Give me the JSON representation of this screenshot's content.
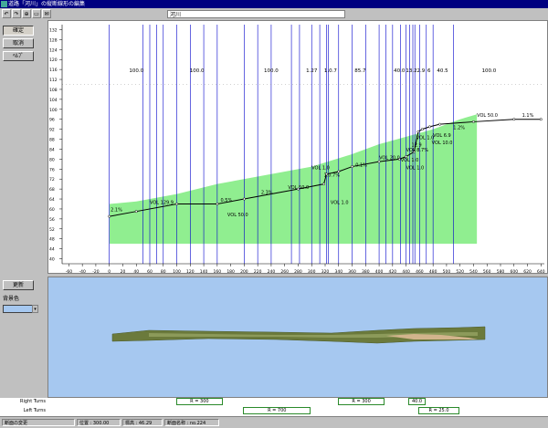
{
  "window": {
    "title": "道路「河川」の縦断線形の編集"
  },
  "toolbar": {
    "buttons": [
      {
        "name": "undo-icon",
        "glyph": "↶"
      },
      {
        "name": "redo-icon",
        "glyph": "↷"
      },
      {
        "name": "zoom-icon",
        "glyph": "⊕"
      },
      {
        "name": "page-icon",
        "glyph": "▭"
      },
      {
        "name": "mail-icon",
        "glyph": "✉"
      }
    ],
    "name_value": "河川"
  },
  "left_panel": {
    "edit_label": "確定",
    "cancel_label": "取消",
    "help_label": "ﾍﾙﾌﾟ",
    "update_label": "更新",
    "bgcolor_label": "背景色",
    "bgcolor_value": "#a6c8f0"
  },
  "chart_data": {
    "type": "line",
    "segment_lengths": [
      {
        "x": 40,
        "label": "100.0"
      },
      {
        "x": 130,
        "label": "100.0"
      },
      {
        "x": 240,
        "label": "100.0"
      },
      {
        "x": 300,
        "label": "1.27"
      },
      {
        "x": 328,
        "label": "1.0.7"
      },
      {
        "x": 372,
        "label": "85.7"
      },
      {
        "x": 430,
        "label": "40.0"
      },
      {
        "x": 448,
        "label": "13.2"
      },
      {
        "x": 462,
        "label": "2.9"
      },
      {
        "x": 474,
        "label": "6"
      },
      {
        "x": 494,
        "label": "40.5"
      },
      {
        "x": 563,
        "label": "100.0"
      }
    ],
    "vertical_lines_x": [
      0,
      50,
      60,
      70,
      80,
      100,
      120,
      140,
      160,
      200,
      220,
      240,
      270,
      282,
      300,
      312,
      322,
      325,
      340,
      360,
      380,
      400,
      410,
      420,
      432,
      440,
      445,
      450,
      453,
      460,
      470,
      480,
      510
    ],
    "profile": [
      [
        0,
        57
      ],
      [
        40,
        59
      ],
      [
        100,
        62
      ],
      [
        160,
        62
      ],
      [
        200,
        64
      ],
      [
        280,
        68
      ],
      [
        318,
        70
      ],
      [
        322,
        74
      ],
      [
        340,
        75
      ],
      [
        360,
        77
      ],
      [
        400,
        79
      ],
      [
        430,
        80
      ],
      [
        440,
        81
      ],
      [
        452,
        83
      ],
      [
        458,
        91
      ],
      [
        464,
        92
      ],
      [
        475,
        93
      ],
      [
        490,
        94
      ],
      [
        540,
        95
      ],
      [
        600,
        96
      ],
      [
        640,
        96
      ]
    ],
    "ground": [
      [
        0,
        62
      ],
      [
        40,
        63
      ],
      [
        100,
        66
      ],
      [
        160,
        70
      ],
      [
        240,
        74
      ],
      [
        300,
        77
      ],
      [
        360,
        82
      ],
      [
        400,
        86
      ],
      [
        440,
        89
      ],
      [
        480,
        92
      ],
      [
        520,
        96
      ],
      [
        545,
        98
      ]
    ],
    "ground_bottom": 46,
    "annotations": [
      {
        "x": 2,
        "y": 59,
        "text": "2.1%"
      },
      {
        "x": 60,
        "y": 62,
        "text": "VOL 129.9"
      },
      {
        "x": 165,
        "y": 63,
        "text": "0.5%"
      },
      {
        "x": 175,
        "y": 57,
        "text": "VOL 50.0"
      },
      {
        "x": 225,
        "y": 66,
        "text": "2.3%"
      },
      {
        "x": 265,
        "y": 68,
        "text": "VOL 50.0"
      },
      {
        "x": 300,
        "y": 76,
        "text": "VOL 1.0"
      },
      {
        "x": 318,
        "y": 73,
        "text": "1.0.7%"
      },
      {
        "x": 328,
        "y": 62,
        "text": "VOL 1.0"
      },
      {
        "x": 365,
        "y": 77,
        "text": "0.1%"
      },
      {
        "x": 400,
        "y": 80,
        "text": "VOL 20.0"
      },
      {
        "x": 440,
        "y": 83,
        "text": "VOL 8.7%"
      },
      {
        "x": 432,
        "y": 79,
        "text": "VOL 1.0"
      },
      {
        "x": 455,
        "y": 88,
        "text": "VOL 1.0"
      },
      {
        "x": 448,
        "y": 85,
        "text": "12.9"
      },
      {
        "x": 478,
        "y": 86,
        "text": "VOL 10.0"
      },
      {
        "x": 480,
        "y": 89,
        "text": "VOL 6.9"
      },
      {
        "x": 510,
        "y": 92,
        "text": "1.2%"
      },
      {
        "x": 545,
        "y": 97,
        "text": "VOL 50.0"
      },
      {
        "x": 612,
        "y": 97,
        "text": "1.1%"
      },
      {
        "x": 440,
        "y": 76,
        "text": "VOL 1.0"
      }
    ],
    "xlabel": "",
    "ylabel": "",
    "x_ticks": [
      -60,
      -40,
      -20,
      0,
      20,
      40,
      60,
      80,
      100,
      120,
      140,
      160,
      180,
      200,
      220,
      240,
      260,
      280,
      300,
      320,
      340,
      360,
      380,
      400,
      420,
      440,
      460,
      480,
      500,
      520,
      540,
      560,
      580,
      600,
      620,
      640
    ],
    "y_ticks": [
      40,
      44,
      48,
      52,
      56,
      60,
      64,
      68,
      72,
      76,
      80,
      84,
      88,
      92,
      96,
      100,
      104,
      108,
      112,
      116,
      120,
      124,
      128,
      132
    ],
    "xlim": [
      -70,
      645
    ],
    "ylim": [
      38,
      134
    ],
    "colors": {
      "ground": "#90ee90",
      "profile": "#000000",
      "vline": "#0000cc"
    }
  },
  "turns": {
    "right_label": "Right Turns",
    "left_label": "Left Turns",
    "right": [
      {
        "from": 100,
        "to": 170,
        "label": "R = 300"
      },
      {
        "from": 340,
        "to": 410,
        "label": "R = 300"
      },
      {
        "from": 445,
        "to": 470,
        "label": "40.0"
      }
    ],
    "left": [
      {
        "from": 200,
        "to": 300,
        "label": "R = 700"
      },
      {
        "from": 460,
        "to": 520,
        "label": "R = 25.0"
      }
    ]
  },
  "status": {
    "mode": "断面の変更",
    "position": "位置 : 300.00",
    "elevation": "標高 : 46.29",
    "section": "断面名称 : no.224"
  }
}
